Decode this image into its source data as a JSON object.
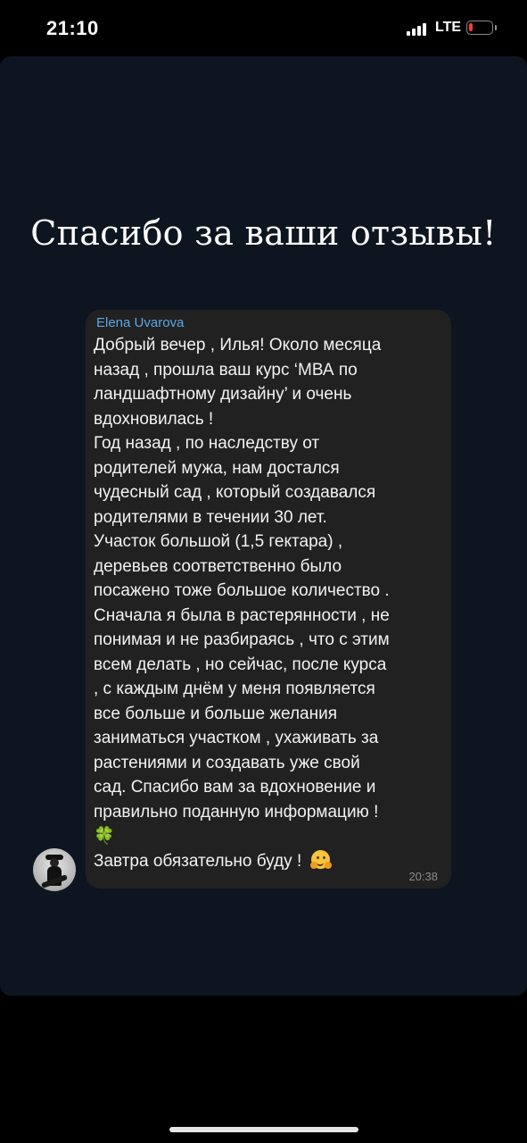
{
  "status_bar": {
    "time": "21:10",
    "network": "LTE"
  },
  "story": {
    "headline": "Спасибо за ваши отзывы!",
    "message": {
      "sender": "Elena Uvarova",
      "text": "Добрый  вечер , Илья! Около месяца\nназад , прошла ваш курс ‘МВА по\nландшафтному дизайну’ и очень\nвдохновилась !\nГод назад , по наследству от\nродителей мужа, нам достался\nчудесный сад , который создавался\nродителями в течении 30 лет.\nУчасток большой (1,5 гектара) ,\nдеревьев соответственно было\nпосажено тоже большое количество .\nСначала я была в растерянности , не\nпонимая и не разбираясь , что с этим\nвсем делать , но сейчас, после курса\n, с каждым днём у меня появляется\nвсе больше и больше желания\nзаниматься участком , ухаживать за\nрастениями и создавать уже свой\nсад. Спасибо вам за вдохновение и\nправильно поданную информацию !\n🍀",
      "last_line": "Завтра обязательно буду ! ",
      "time": "20:38"
    }
  },
  "colors": {
    "background": "#000000",
    "story_background": "#0d1620",
    "bubble": "#212121",
    "sender_name": "#5aa7e6",
    "battery_low": "#ff3b30"
  },
  "icons": [
    "signal-icon",
    "battery-icon",
    "hugging-face-emoji",
    "four-leaf-clover-emoji",
    "avatar"
  ]
}
